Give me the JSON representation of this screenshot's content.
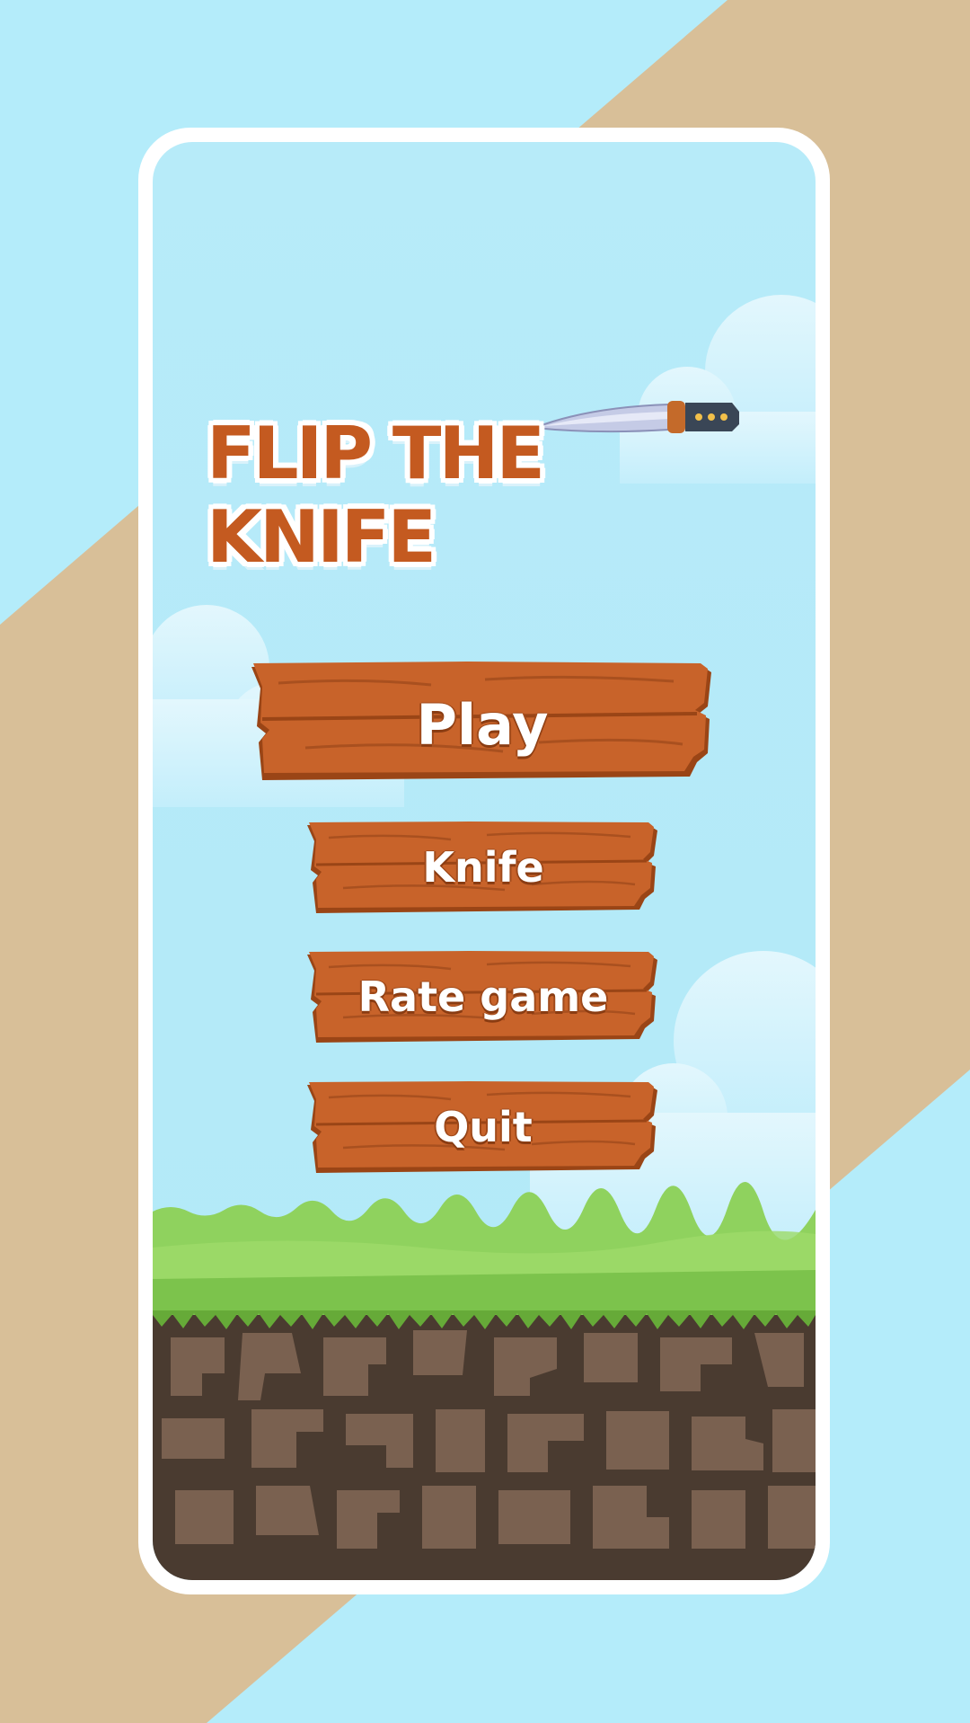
{
  "game": {
    "title": "FLIP THE KNIFE",
    "menu": {
      "play_label": "Play",
      "knife_label": "Knife",
      "rate_label": "Rate game",
      "quit_label": "Quit"
    }
  },
  "colors": {
    "sky": "#b4ecfa",
    "sand": "#d8bf98",
    "wood": "#c8632a",
    "wood_dark": "#9a4516",
    "title": "#c45a20",
    "grass": "#8fd25e",
    "dirt": "#4a3b30",
    "stone": "#7a6150"
  },
  "icons": {
    "title_knife": "knife-icon"
  }
}
